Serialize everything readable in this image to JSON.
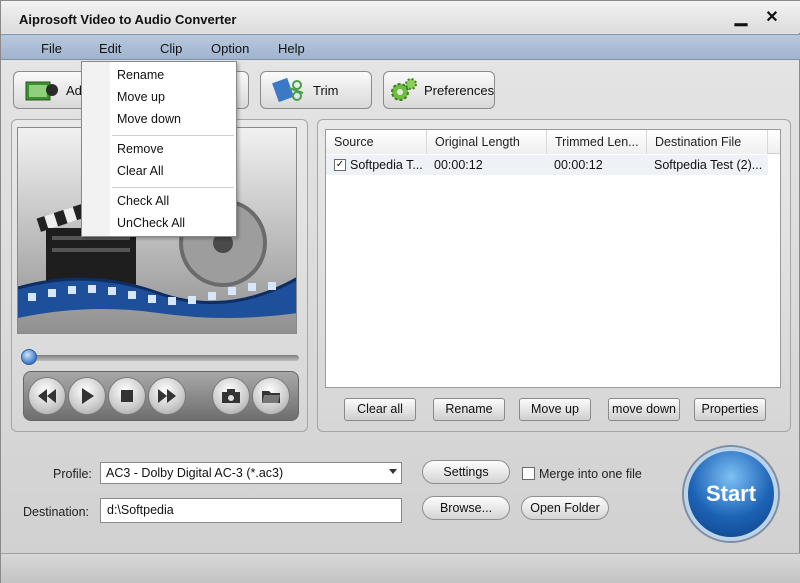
{
  "window": {
    "title": "Aiprosoft Video to Audio Converter",
    "minimize": "▁",
    "close": "✕"
  },
  "menu": {
    "file": "File",
    "edit": "Edit",
    "clip": "Clip",
    "option": "Option",
    "help": "Help"
  },
  "toolbar": {
    "add": "Add",
    "trim": "Trim",
    "preferences": "Preferences"
  },
  "context_menu": {
    "items": [
      "Rename",
      "Move up",
      "Move down",
      "Remove",
      "Clear All",
      "Check All",
      "UnCheck All"
    ]
  },
  "file_list": {
    "columns": [
      "Source",
      "Original Length",
      "Trimmed Len...",
      "Destination File"
    ],
    "rows": [
      {
        "checked": true,
        "source": "Softpedia T...",
        "original_length": "00:00:12",
        "trimmed_length": "00:00:12",
        "destination": "Softpedia Test (2)..."
      }
    ]
  },
  "list_buttons": {
    "clear_all": "Clear all",
    "rename": "Rename",
    "move_up": "Move up",
    "move_down": "move down",
    "properties": "Properties"
  },
  "output": {
    "profile_label": "Profile:",
    "profile_value": "AC3 - Dolby Digital AC-3 (*.ac3)",
    "destination_label": "Destination:",
    "destination_value": "d:\\Softpedia",
    "settings": "Settings",
    "browse": "Browse...",
    "open_folder": "Open Folder",
    "merge_label": "Merge into one file",
    "merge_checked": false,
    "start": "Start"
  },
  "icons": {
    "play_controls": [
      "rewind-icon",
      "play-icon",
      "stop-icon",
      "fast-forward-icon",
      "snapshot-icon",
      "folder-icon"
    ]
  },
  "colors": {
    "menubar": "#a9bcd5",
    "start_button": "#1c63b5"
  }
}
